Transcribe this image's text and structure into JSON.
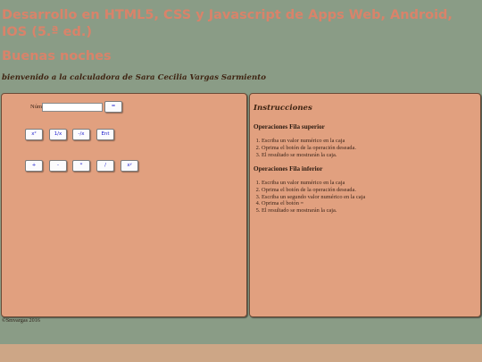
{
  "header": {
    "title": "Desarrollo en HTML5, CSS y Javascript de Apps Web, Android, IOS (5.ª ed.)",
    "greeting": "Buenas noches",
    "welcome": "bienvenido a la calculadora de Sara Cecilia Vargas Sarmiento"
  },
  "calculator": {
    "number_label": "Número:",
    "number_value": "",
    "equals_label": "=",
    "top_row": [
      "x²",
      "1/x",
      "-/x",
      "Ent"
    ],
    "bottom_row": [
      "+",
      "-",
      "*",
      "/",
      "xʸ"
    ]
  },
  "instructions": {
    "title": "Instrucciones",
    "top": {
      "heading": "Operaciones Fila superior",
      "steps": [
        "Escriba un valor numérico en la caja",
        "Oprima el botón de la operación deseada.",
        "El resultado se mostrarán la caja."
      ]
    },
    "bottom": {
      "heading": "Operaciones Fila inferior",
      "steps": [
        "Escriba un valor numérico en la caja",
        "Oprima el botón de la operación deseada.",
        "Escriba un segundo valor numérico en la caja",
        "Oprima el botón =",
        "El resultado se mostrarán la caja."
      ]
    }
  },
  "footer": {
    "copyright": "©Smvargas 2016"
  }
}
